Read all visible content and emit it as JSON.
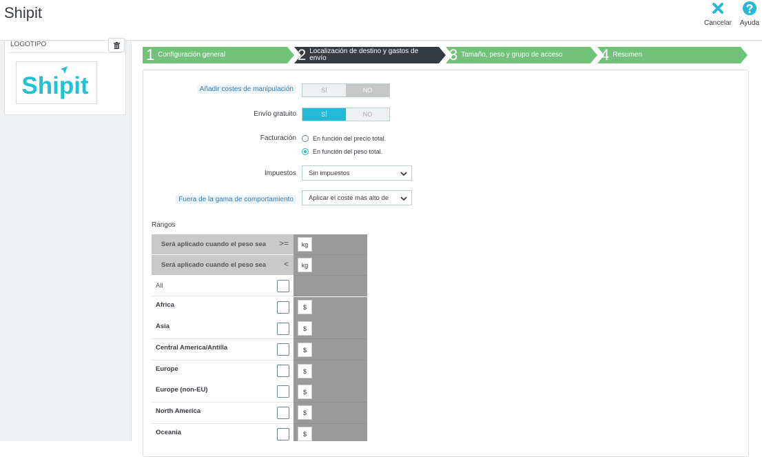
{
  "header": {
    "title": "Shipit",
    "cancel_label": "Cancelar",
    "help_label": "Ayuda"
  },
  "logo_panel": {
    "title": "LOGOTIPO",
    "logo_text": "Shipit"
  },
  "wizard": {
    "steps": [
      {
        "number": "1",
        "label": "Configuración general",
        "state": "done"
      },
      {
        "number": "2",
        "label": "Localización de destino y gastos de envío",
        "state": "current"
      },
      {
        "number": "3",
        "label": "Tamaño, peso y grupo de acceso",
        "state": "todo"
      },
      {
        "number": "4",
        "label": "Resumen",
        "state": "todo"
      }
    ]
  },
  "form": {
    "handling": {
      "label": "Añadir costes de manipulación",
      "yes": "SÍ",
      "no": "NO",
      "selected": "NO"
    },
    "free_shipping": {
      "label": "Envío gratuito",
      "yes": "SÍ",
      "no": "NO",
      "selected": "SÍ"
    },
    "billing": {
      "label": "Facturación",
      "option_price": "En función del precio total.",
      "option_weight": "En función del peso total.",
      "selected": "weight"
    },
    "taxes": {
      "label": "Impuestos",
      "value": "Sin impuestos"
    },
    "out_of_range": {
      "label": "Fuera de la gama de comportamiento",
      "value": "Aplicar el coste más alto de"
    }
  },
  "ranges": {
    "title": "Rangos",
    "row_ge": {
      "label": "Será aplicado cuando el peso sea",
      "operator": ">=",
      "unit": "kg"
    },
    "row_lt": {
      "label": "Será aplicado cuando el peso sea",
      "operator": "<",
      "unit": "kg"
    },
    "all_label": "All",
    "currency": "$",
    "zones": [
      "Africa",
      "Asia",
      "Central America/Antilla",
      "Europe",
      "Europe (non-EU)",
      "North America",
      "Oceania"
    ]
  },
  "colors": {
    "step_done": "#72c279",
    "step_current": "#363a41",
    "accent": "#25b9d7",
    "brand": "#1fc3d1"
  }
}
